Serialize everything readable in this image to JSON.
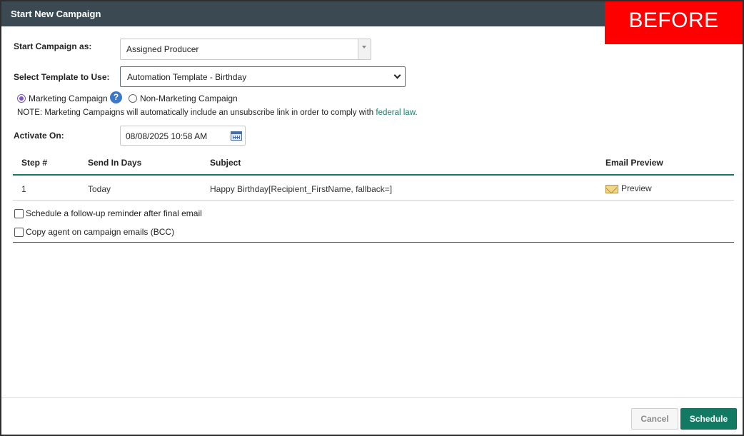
{
  "dialog": {
    "title": "Start New Campaign",
    "badge": "BEFORE"
  },
  "form": {
    "start_as_label": "Start Campaign as:",
    "start_as_value": "Assigned Producer",
    "template_label": "Select Template to Use:",
    "template_value": "Automation Template - Birthday",
    "campaign_type": {
      "marketing_label": "Marketing Campaign",
      "marketing_selected": true,
      "help_icon": "?",
      "non_marketing_label": "Non-Marketing Campaign"
    },
    "note_prefix": "NOTE: Marketing Campaigns will automatically include an unsubscribe link in order to comply with ",
    "note_link": "federal law",
    "note_suffix": ".",
    "activate_label": "Activate On:",
    "activate_value": "08/08/2025 10:58 AM"
  },
  "steps_table": {
    "headers": [
      "Step #",
      "Send In Days",
      "Subject",
      "Email Preview"
    ],
    "rows": [
      {
        "step": "1",
        "send_in_days": "Today",
        "subject": "Happy Birthday[Recipient_FirstName, fallback=]",
        "preview_label": "Preview"
      }
    ]
  },
  "options": {
    "followup_label": "Schedule a follow-up reminder after final email",
    "bcc_label": "Copy agent on campaign emails (BCC)"
  },
  "buttons": {
    "cancel": "Cancel",
    "schedule": "Schedule"
  },
  "colors": {
    "titlebar": "#3b4a52",
    "badge": "#ff0000",
    "accent_green": "#127a63",
    "radio_purple": "#7b56c7",
    "help_blue": "#3b78c8"
  },
  "icons": [
    "help-icon",
    "calendar-icon",
    "envelope-icon",
    "dropdown-arrow-icon",
    "chevron-down-icon"
  ]
}
